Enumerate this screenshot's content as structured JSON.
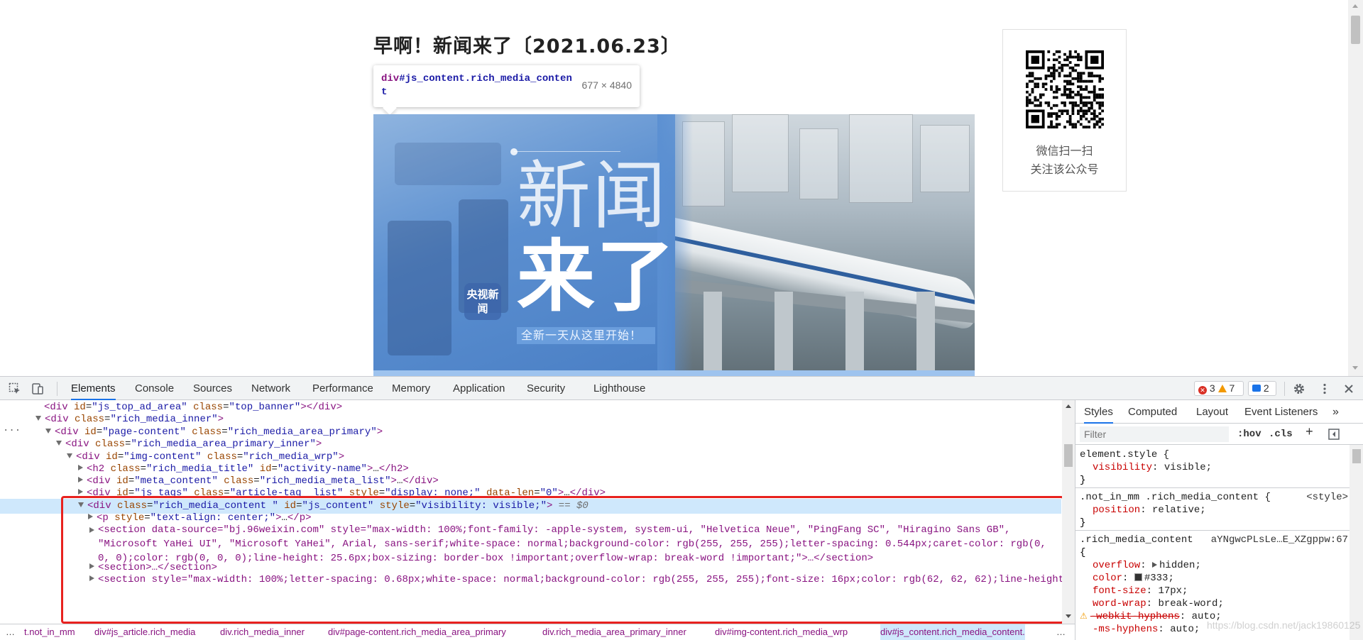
{
  "page": {
    "title": "早啊！新闻来了〔2021.06.23〕",
    "tooltip": {
      "tag": "div",
      "selector_rest": "#js_content.rich_media_content",
      "size": "677 × 4840"
    },
    "hero": {
      "line1": "新闻",
      "line2": "来了",
      "badge": "央视新闻",
      "slogan": "全新一天从这里开始！"
    },
    "qr": {
      "caption_line1": "微信扫一扫",
      "caption_line2": "关注该公众号"
    }
  },
  "devtools": {
    "tabs": [
      "Elements",
      "Console",
      "Sources",
      "Network",
      "Performance",
      "Memory",
      "Application",
      "Security",
      "Lighthouse"
    ],
    "active_tab": "Elements",
    "badges": {
      "errors": "3",
      "warnings": "7",
      "messages": "2"
    },
    "dom": {
      "l1": {
        "tag": "div",
        "attrs": [
          [
            "id",
            "js_top_ad_area"
          ],
          [
            "class",
            "top_banner"
          ]
        ],
        "close": "</div>"
      },
      "l2": {
        "tag": "div",
        "attrs": [
          [
            "class",
            "rich_media_inner"
          ]
        ]
      },
      "l3": {
        "tag": "div",
        "attrs": [
          [
            "id",
            "page-content"
          ],
          [
            "class",
            "rich_media_area_primary"
          ]
        ]
      },
      "l4": {
        "tag": "div",
        "attrs": [
          [
            "class",
            "rich_media_area_primary_inner"
          ]
        ]
      },
      "l5": {
        "tag": "div",
        "attrs": [
          [
            "id",
            "img-content"
          ],
          [
            "class",
            "rich_media_wrp"
          ]
        ]
      },
      "l6": {
        "tag": "h2",
        "attrs": [
          [
            "class",
            "rich_media_title"
          ],
          [
            "id",
            "activity-name"
          ]
        ],
        "close": "…</h2>"
      },
      "l7": {
        "tag": "div",
        "attrs": [
          [
            "id",
            "meta_content"
          ],
          [
            "class",
            "rich_media_meta_list"
          ]
        ],
        "close": "…</div>"
      },
      "l8": {
        "tag": "div",
        "attrs": [
          [
            "id",
            "js_tags"
          ],
          [
            "class",
            "article-tag__list"
          ],
          [
            "style",
            "display: none;"
          ],
          [
            "data-len",
            "0"
          ]
        ],
        "close": "…</div>"
      },
      "l9": {
        "tag": "div",
        "attrs": [
          [
            "class",
            "rich_media_content "
          ],
          [
            "id",
            "js_content"
          ],
          [
            "style",
            "visibility: visible;"
          ]
        ],
        "suffix": " == $0"
      },
      "l10": {
        "tag": "p",
        "attrs": [
          [
            "style",
            "text-align: center;"
          ]
        ],
        "close": "…</p>"
      },
      "l11_text": "<section data-source=\"bj.96weixin.com\" style=\"max-width: 100%;font-family: -apple-system, system-ui, \"Helvetica Neue\", \"PingFang SC\", \"Hiragino Sans GB\", \"Microsoft YaHei UI\", \"Microsoft YaHei\", Arial, sans-serif;white-space: normal;background-color: rgb(255, 255, 255);letter-spacing: 0.544px;caret-color: rgb(0, 0, 0);color: rgb(0, 0, 0);line-height: 25.6px;box-sizing: border-box !important;overflow-wrap: break-word !important;\">…</section>",
      "l12": "<section>…</section>",
      "l13_text": "<section style=\"max-width: 100%;letter-spacing: 0.68px;white-space: normal;background-color: rgb(255, 255, 255);font-size: 16px;color: rgb(62, 62, 62);line-height:"
    },
    "breadcrumbs": [
      "t.not_in_mm",
      "div#js_article.rich_media",
      "div.rich_media_inner",
      "div#page-content.rich_media_area_primary",
      "div.rich_media_area_primary_inner",
      "div#img-content.rich_media_wrp",
      "div#js_content.rich_media_content."
    ],
    "styles": {
      "tabs": [
        "Styles",
        "Computed",
        "Layout",
        "Event Listeners"
      ],
      "filter_placeholder": "Filter",
      "hov": ":hov",
      "cls": ".cls",
      "rules": [
        {
          "selector": "element.style {",
          "source": "",
          "props": [
            [
              "visibility",
              "visible"
            ]
          ]
        },
        {
          "selector": ".not_in_mm .rich_media_content {",
          "source": "<style>",
          "props": [
            [
              "position",
              "relative"
            ]
          ]
        },
        {
          "selector": ".rich_media_content",
          "source": "aYNgwcPLsLe…E_XZgppw:67",
          "props": [
            [
              "overflow",
              "hidden"
            ],
            [
              "color",
              "#333"
            ],
            [
              "font-size",
              "17px"
            ],
            [
              "word-wrap",
              "break-word"
            ],
            [
              "-webkit-hyphens",
              "auto"
            ],
            [
              "-ms-hyphens",
              "auto"
            ]
          ]
        }
      ]
    },
    "watermark": "https://blog.csdn.net/jack19860125"
  }
}
